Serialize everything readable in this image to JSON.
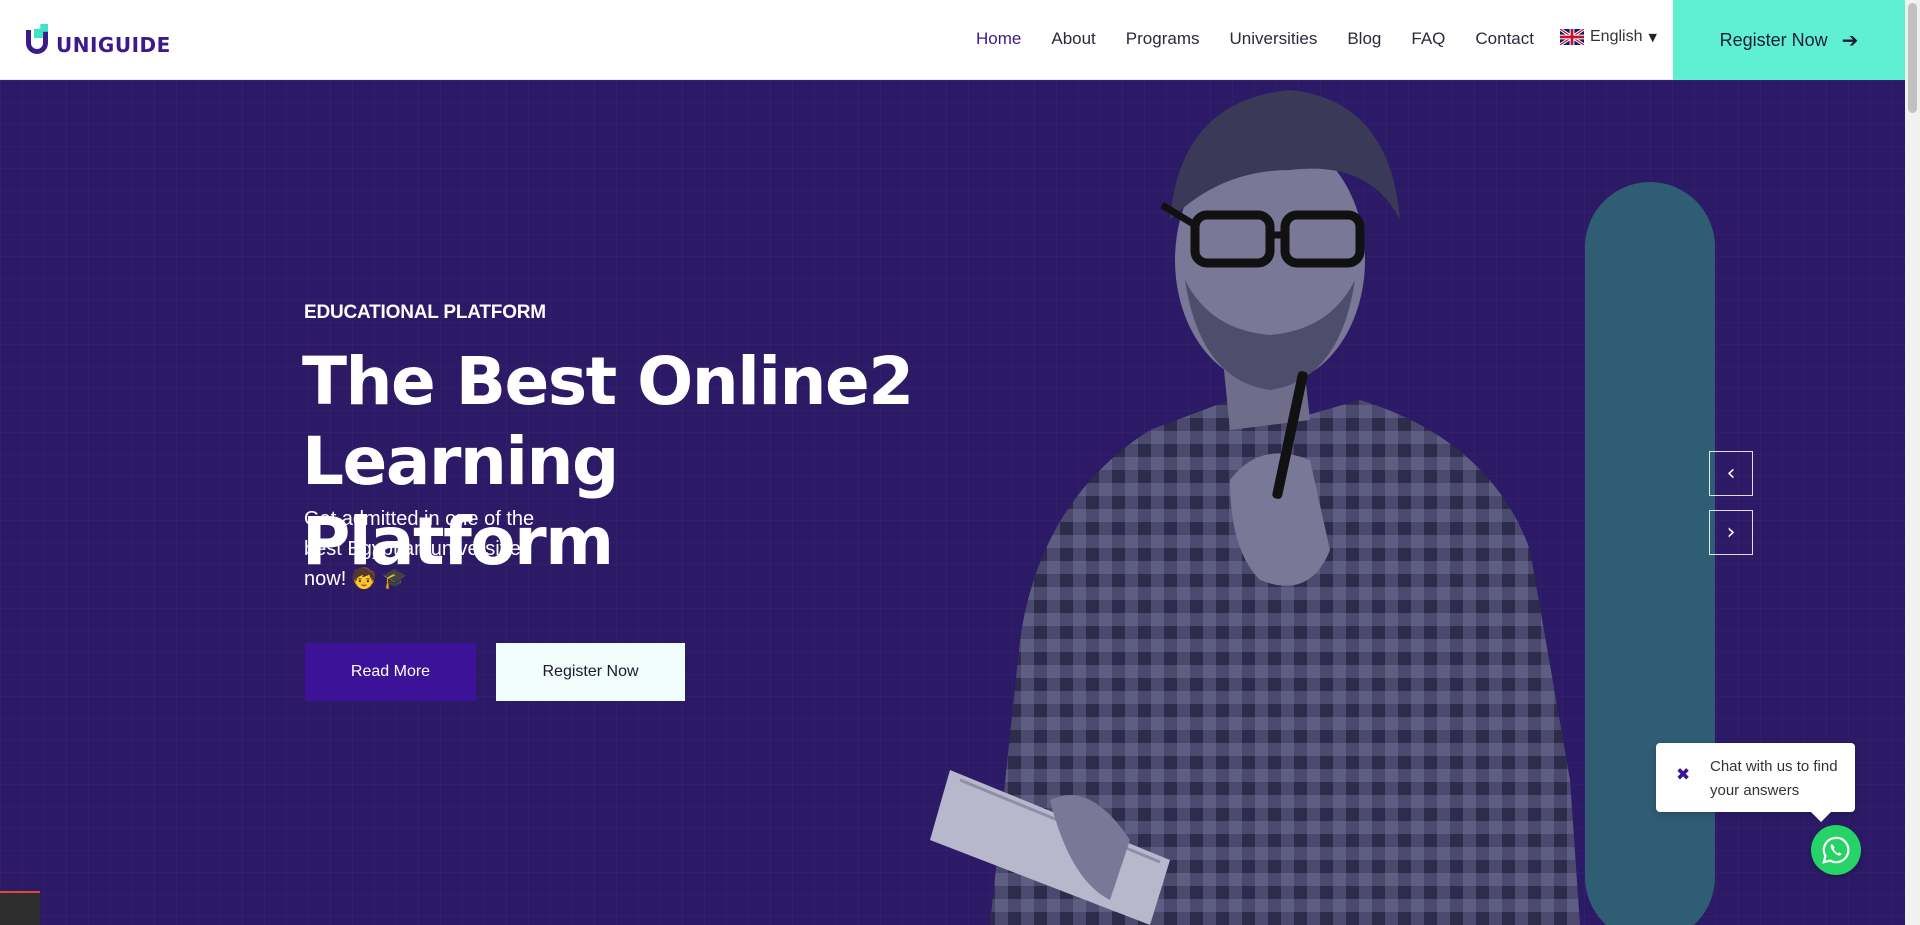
{
  "header": {
    "brand": "UNIGUIDE",
    "nav": [
      {
        "label": "Home",
        "active": true
      },
      {
        "label": "About"
      },
      {
        "label": "Programs"
      },
      {
        "label": "Universities"
      },
      {
        "label": "Blog"
      },
      {
        "label": "FAQ"
      },
      {
        "label": "Contact"
      }
    ],
    "language": {
      "label": "English",
      "flag": "uk-flag-icon"
    },
    "cta_label": "Register Now"
  },
  "hero": {
    "eyebrow": "EDUCATIONAL PLATFORM",
    "headline_line1": "The Best Online2 Learning",
    "headline_line2": "Platform",
    "subtext": "Get admitted in one of the best Egyptian universities now! 🧒 🎓",
    "read_more_label": "Read More",
    "register_label": "Register Now"
  },
  "chat": {
    "text": "Chat with us to find your answers"
  },
  "colors": {
    "primary": "#3c1398",
    "accent": "#5ff0d2",
    "hero_bg": "#2c1a67",
    "whatsapp": "#25d366"
  }
}
